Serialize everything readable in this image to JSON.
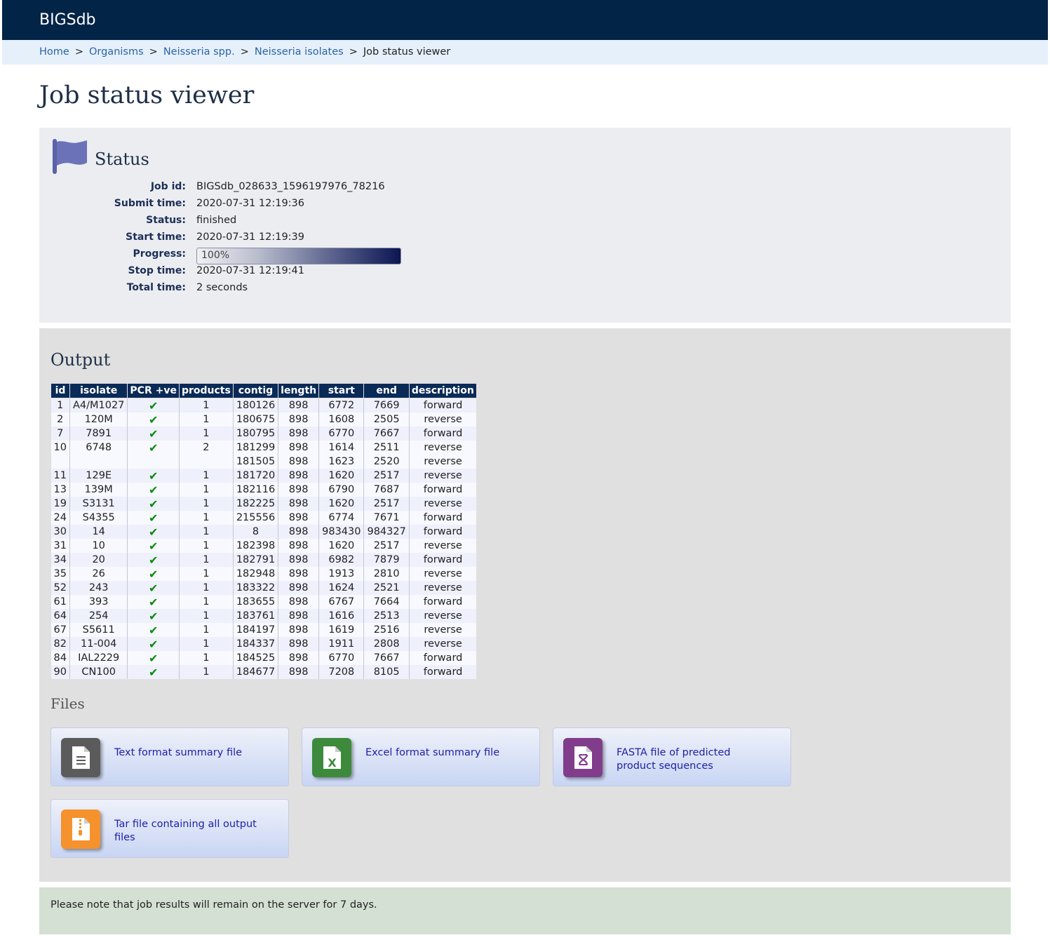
{
  "header": {
    "brand": "BIGSdb"
  },
  "breadcrumb": {
    "links": [
      "Home",
      "Organisms",
      "Neisseria spp.",
      "Neisseria isolates"
    ],
    "current": "Job status viewer"
  },
  "page_title": "Job status viewer",
  "status": {
    "heading": "Status",
    "fields": [
      {
        "key": "Job id:",
        "value": "BIGSdb_028633_1596197976_78216"
      },
      {
        "key": "Submit time:",
        "value": "2020-07-31 12:19:36"
      },
      {
        "key": "Status:",
        "value": "finished"
      },
      {
        "key": "Start time:",
        "value": "2020-07-31 12:19:39"
      },
      {
        "key": "Progress:",
        "value": "100%"
      },
      {
        "key": "Stop time:",
        "value": "2020-07-31 12:19:41"
      },
      {
        "key": "Total time:",
        "value": "2 seconds"
      }
    ],
    "progress_fraction": 1.0
  },
  "output": {
    "heading": "Output",
    "columns": [
      "id",
      "isolate",
      "PCR +ve",
      "products",
      "contig",
      "length",
      "start",
      "end",
      "description"
    ],
    "rows": [
      [
        "1",
        "A4/M1027",
        "✔",
        "1",
        "180126",
        "898",
        "6772",
        "7669",
        "forward"
      ],
      [
        "2",
        "120M",
        "✔",
        "1",
        "180675",
        "898",
        "1608",
        "2505",
        "reverse"
      ],
      [
        "7",
        "7891",
        "✔",
        "1",
        "180795",
        "898",
        "6770",
        "7667",
        "forward"
      ],
      [
        "10",
        "6748",
        "✔",
        "2",
        "181299",
        "898",
        "1614",
        "2511",
        "reverse"
      ],
      [
        "",
        "",
        "",
        "",
        "181505",
        "898",
        "1623",
        "2520",
        "reverse"
      ],
      [
        "11",
        "129E",
        "✔",
        "1",
        "181720",
        "898",
        "1620",
        "2517",
        "reverse"
      ],
      [
        "13",
        "139M",
        "✔",
        "1",
        "182116",
        "898",
        "6790",
        "7687",
        "forward"
      ],
      [
        "19",
        "S3131",
        "✔",
        "1",
        "182225",
        "898",
        "1620",
        "2517",
        "reverse"
      ],
      [
        "24",
        "S4355",
        "✔",
        "1",
        "215556",
        "898",
        "6774",
        "7671",
        "forward"
      ],
      [
        "30",
        "14",
        "✔",
        "1",
        "8",
        "898",
        "983430",
        "984327",
        "forward"
      ],
      [
        "31",
        "10",
        "✔",
        "1",
        "182398",
        "898",
        "1620",
        "2517",
        "reverse"
      ],
      [
        "34",
        "20",
        "✔",
        "1",
        "182791",
        "898",
        "6982",
        "7879",
        "forward"
      ],
      [
        "35",
        "26",
        "✔",
        "1",
        "182948",
        "898",
        "1913",
        "2810",
        "reverse"
      ],
      [
        "52",
        "243",
        "✔",
        "1",
        "183322",
        "898",
        "1624",
        "2521",
        "reverse"
      ],
      [
        "61",
        "393",
        "✔",
        "1",
        "183655",
        "898",
        "6767",
        "7664",
        "forward"
      ],
      [
        "64",
        "254",
        "✔",
        "1",
        "183761",
        "898",
        "1616",
        "2513",
        "reverse"
      ],
      [
        "67",
        "S5611",
        "✔",
        "1",
        "184197",
        "898",
        "1619",
        "2516",
        "reverse"
      ],
      [
        "82",
        "11-004",
        "✔",
        "1",
        "184337",
        "898",
        "1911",
        "2808",
        "reverse"
      ],
      [
        "84",
        "IAL2229",
        "✔",
        "1",
        "184525",
        "898",
        "6770",
        "7667",
        "forward"
      ],
      [
        "90",
        "CN100",
        "✔",
        "1",
        "184677",
        "898",
        "7208",
        "8105",
        "forward"
      ]
    ]
  },
  "files": {
    "heading": "Files",
    "items": [
      {
        "label": "Text format summary file",
        "icon": "text-file-icon",
        "color": "#5b5b5b"
      },
      {
        "label": "Excel format summary file",
        "icon": "excel-file-icon",
        "color": "#3d8a3d"
      },
      {
        "label": "FASTA file of predicted product sequences",
        "icon": "dna-file-icon",
        "color": "#813d8c"
      },
      {
        "label": "Tar file containing all output files",
        "icon": "archive-file-icon",
        "color": "#f5922e"
      }
    ]
  },
  "note": "Please note that job results will remain on the server for 7 days."
}
